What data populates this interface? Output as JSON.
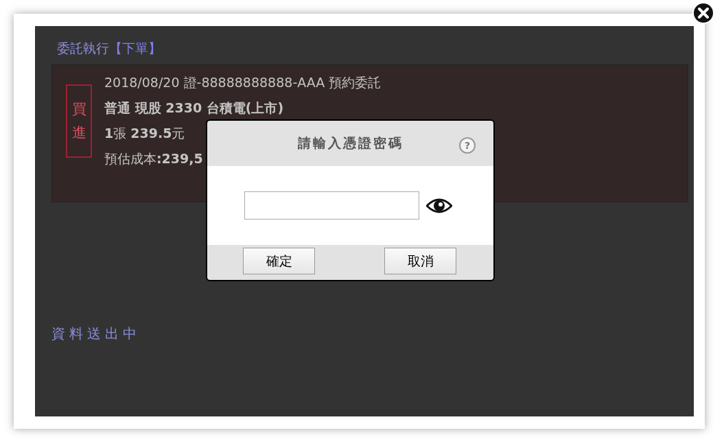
{
  "heading": {
    "label": "委託執行",
    "bracket": "【下單】"
  },
  "order_card": {
    "stamp": "買進",
    "lines": [
      {
        "text": "2018/08/20 證-88888888888-AAA 預約委託",
        "bold": false
      },
      {
        "text": "普通 現股 2330 台積電(上市)",
        "bold": true
      },
      {
        "text": "**1**張 **239.5**元",
        "bold": false
      },
      {
        "text": "預估成本**:239,5**",
        "bold": false
      }
    ]
  },
  "status": "資料送出中",
  "dialog": {
    "title": "請輸入憑證密碼",
    "help_icon": "?",
    "buttons": [
      "確定",
      "取消"
    ]
  }
}
